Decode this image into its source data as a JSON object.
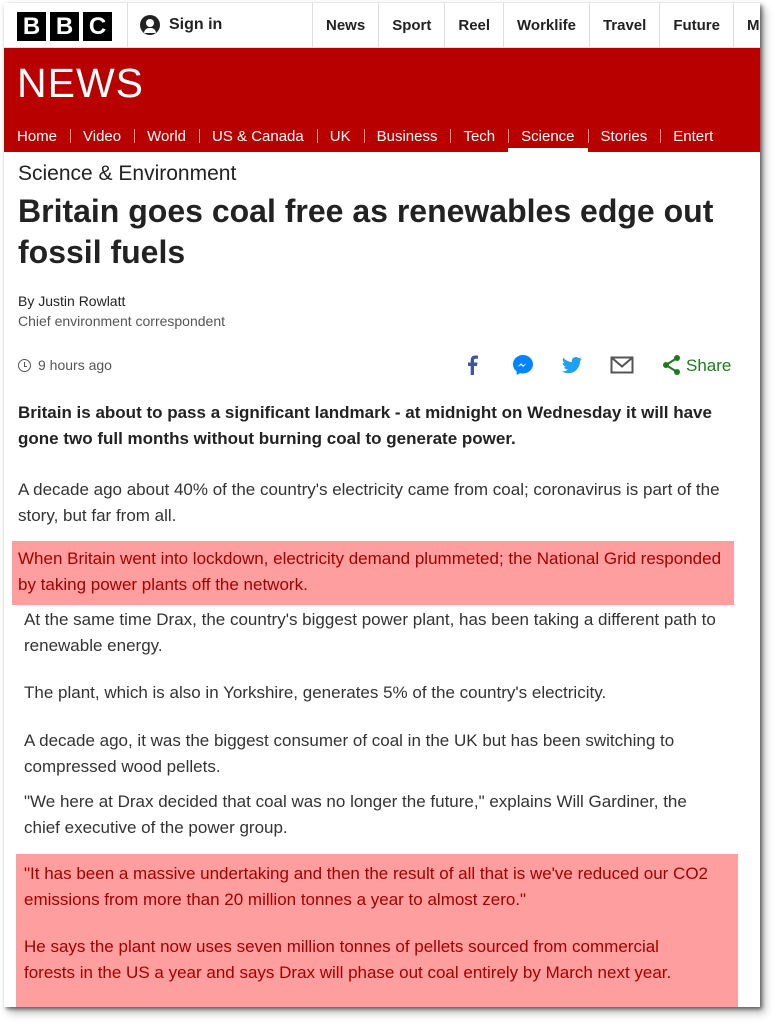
{
  "brand": {
    "letters": [
      "B",
      "B",
      "C"
    ]
  },
  "topbar": {
    "signin_label": "Sign in",
    "nav": [
      "News",
      "Sport",
      "Reel",
      "Worklife",
      "Travel",
      "Future",
      "M"
    ]
  },
  "news_logo": "NEWS",
  "rednav": [
    "Home",
    "Video",
    "World",
    "US & Canada",
    "UK",
    "Business",
    "Tech",
    "Science",
    "Stories",
    "Entert"
  ],
  "rednav_active": "Science",
  "article": {
    "section": "Science & Environment",
    "headline": "Britain goes coal free as renewables edge out fossil fuels",
    "author": "By Justin Rowlatt",
    "author_role": "Chief environment correspondent",
    "timestamp": "9 hours ago",
    "share_label": "Share",
    "intro": "Britain is about to pass a significant landmark - at midnight on Wednesday it will have gone two full months without burning coal to generate power.",
    "paragraphs": [
      "A decade ago about 40% of the country's electricity came from coal; coronavirus is part of the story, but far from all.",
      "When Britain went into lockdown, electricity demand plummeted; the National Grid responded by taking power plants off the network.",
      "At the same time Drax, the country's biggest power plant, has been taking a different path to renewable energy.",
      "The plant, which is also in Yorkshire, generates 5% of the country's electricity.",
      "A decade ago, it was the biggest consumer of coal in the UK but has been switching to compressed wood pellets.",
      "\"We here at Drax decided that coal was no longer the future,\" explains Will Gardiner, the chief executive of the power group.",
      "\"It has been a massive undertaking and then the result of all that is we've reduced our CO2 emissions from more than 20 million tonnes a year to almost zero.\"",
      "He says the plant now uses seven million tonnes of pellets sourced from commercial forests in the US a year and says Drax will phase out coal entirely by March next year."
    ]
  },
  "colors": {
    "bbc_red": "#b80000",
    "highlight": "#ff9e9e",
    "highlight_text": "#a30000",
    "facebook": "#3b5998",
    "messenger": "#0084ff",
    "twitter": "#1da1f2",
    "share_green": "#1f7a1f"
  },
  "icons": [
    "user-icon",
    "clock-icon",
    "facebook-icon",
    "messenger-icon",
    "twitter-icon",
    "email-icon",
    "share-icon"
  ]
}
